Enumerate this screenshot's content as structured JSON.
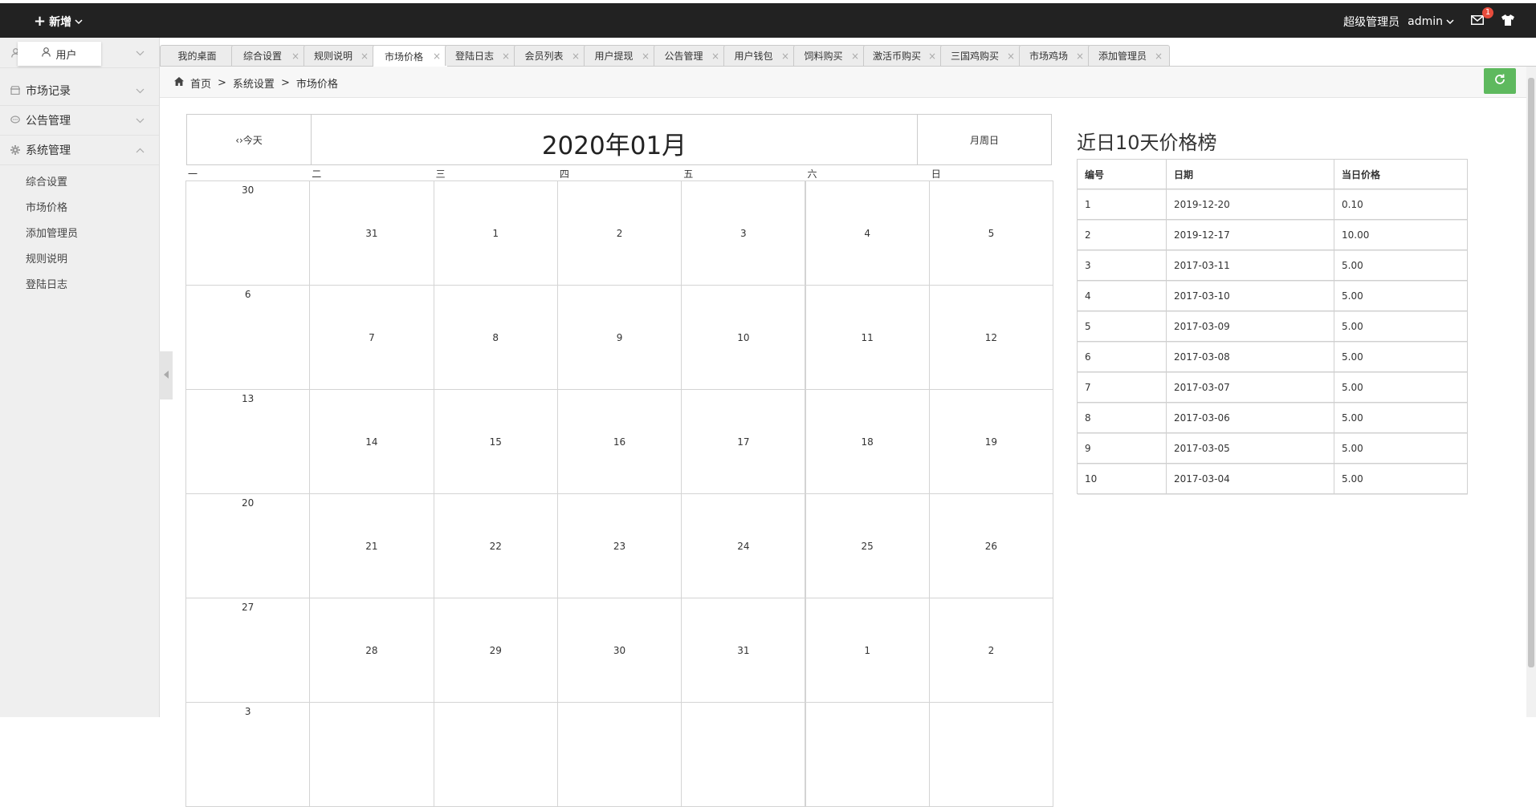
{
  "topbar": {
    "add_label": "新增",
    "role": "超级管理员",
    "username": "admin",
    "mail_count": "1"
  },
  "sidebar": {
    "user_popup": "用户",
    "menus": [
      {
        "label": "市场记录",
        "icon": "shop-icon"
      },
      {
        "label": "公告管理",
        "icon": "chat-icon"
      },
      {
        "label": "系统管理",
        "icon": "gear-icon"
      }
    ],
    "submenu": [
      "综合设置",
      "市场价格",
      "添加管理员",
      "规则说明",
      "登陆日志"
    ]
  },
  "tabs": [
    "我的桌面",
    "综合设置",
    "规则说明",
    "市场价格",
    "登陆日志",
    "会员列表",
    "用户提现",
    "公告管理",
    "用户钱包",
    "饲料购买",
    "激活币购买",
    "三国鸡购买",
    "市场鸡场",
    "添加管理员"
  ],
  "active_tab": "市场价格",
  "breadcrumb": [
    "首页",
    "系统设置",
    "市场价格"
  ],
  "calendar": {
    "today_label": "‹›今天",
    "title": "2020年01月",
    "mode_label": "月周日",
    "weekdays": [
      "一",
      "二",
      "三",
      "四",
      "五",
      "六",
      "日"
    ],
    "weeks": [
      [
        "30",
        "31",
        "1",
        "2",
        "3",
        "4",
        "5"
      ],
      [
        "6",
        "7",
        "8",
        "9",
        "10",
        "11",
        "12"
      ],
      [
        "13",
        "14",
        "15",
        "16",
        "17",
        "18",
        "19"
      ],
      [
        "20",
        "21",
        "22",
        "23",
        "24",
        "25",
        "26"
      ],
      [
        "27",
        "28",
        "29",
        "30",
        "31",
        "1",
        "2"
      ],
      [
        "3",
        "",
        "",
        "",
        "",
        "",
        ""
      ]
    ]
  },
  "ranking": {
    "title": "近日10天价格榜",
    "headers": [
      "编号",
      "日期",
      "当日价格"
    ],
    "rows": [
      [
        "1",
        "2019-12-20",
        "0.10"
      ],
      [
        "2",
        "2019-12-17",
        "10.00"
      ],
      [
        "3",
        "2017-03-11",
        "5.00"
      ],
      [
        "4",
        "2017-03-10",
        "5.00"
      ],
      [
        "5",
        "2017-03-09",
        "5.00"
      ],
      [
        "6",
        "2017-03-08",
        "5.00"
      ],
      [
        "7",
        "2017-03-07",
        "5.00"
      ],
      [
        "8",
        "2017-03-06",
        "5.00"
      ],
      [
        "9",
        "2017-03-05",
        "5.00"
      ],
      [
        "10",
        "2017-03-04",
        "5.00"
      ]
    ]
  },
  "colors": {
    "topbar": "#222222",
    "refresh": "#5eb95e",
    "badge": "#e74c3c"
  }
}
